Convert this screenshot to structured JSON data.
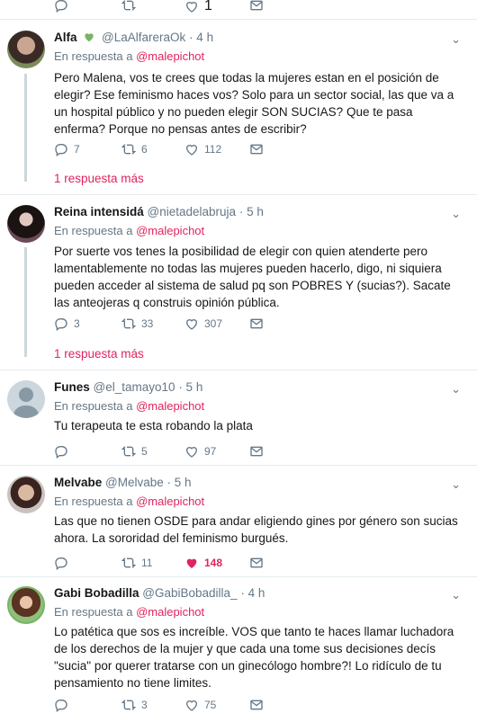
{
  "top": {
    "retweets": "",
    "likes": "1"
  },
  "tweets": [
    {
      "name": "Alfa",
      "handle": "@LaAlfareraOk",
      "time": "· 4 h",
      "reply_prefix": "En respuesta a",
      "reply_target": "@malepichot",
      "text": "Pero Malena, vos te crees que todas la mujeres estan en el posición de elegir? Ese feminismo haces vos? Solo para un sector social, las que va a un hospital público y no pueden elegir SON SUCIAS? Que te pasa enferma? Porque no pensas antes de escribir?",
      "replies": "7",
      "retweets": "6",
      "likes": "112",
      "more": "1 respuesta más"
    },
    {
      "name": "Reina intensidá",
      "handle": "@nietadelabruja",
      "time": "· 5 h",
      "reply_prefix": "En respuesta a",
      "reply_target": "@malepichot",
      "text": "Por suerte vos tenes la posibilidad de elegir con quien atenderte pero lamentablemente no todas las mujeres pueden hacerlo, digo, ni siquiera pueden acceder al sistema de salud pq son POBRES Y (sucias?). Sacate las anteojeras q construis opinión pública.",
      "replies": "3",
      "retweets": "33",
      "likes": "307",
      "more": "1 respuesta más"
    },
    {
      "name": "Funes",
      "handle": "@el_tamayo10",
      "time": "· 5 h",
      "reply_prefix": "En respuesta a",
      "reply_target": "@malepichot",
      "text": "Tu terapeuta te esta robando la plata",
      "replies": "",
      "retweets": "5",
      "likes": "97"
    },
    {
      "name": "Melvabe",
      "handle": "@Melvabe",
      "time": "· 5 h",
      "reply_prefix": "En respuesta a",
      "reply_target": "@malepichot",
      "text": "Las que no tienen OSDE para andar eligiendo gines por género son sucias ahora. La sororidad del feminismo burgués.",
      "replies": "",
      "retweets": "11",
      "likes": "148"
    },
    {
      "name": "Gabi Bobadilla",
      "handle": "@GabiBobadilla_",
      "time": "· 4 h",
      "reply_prefix": "En respuesta a",
      "reply_target": "@malepichot",
      "text": "Lo patética que sos es increíble. VOS que tanto te haces llamar luchadora de los derechos de la mujer y que cada una tome sus decisiones decís \"sucia\" por querer tratarse con un ginecólogo hombre?! Lo ridículo de tu pensamiento no tiene limites.",
      "replies": "",
      "retweets": "3",
      "likes": "75"
    }
  ],
  "colors": {
    "accent": "#e0245e",
    "muted": "#657786",
    "border": "#e6ecf0",
    "verified": "#79b465"
  },
  "icons": {
    "reply": "reply-icon",
    "retweet": "retweet-icon",
    "like": "heart-icon",
    "dm": "envelope-icon",
    "menu": "chevron-down-icon"
  }
}
